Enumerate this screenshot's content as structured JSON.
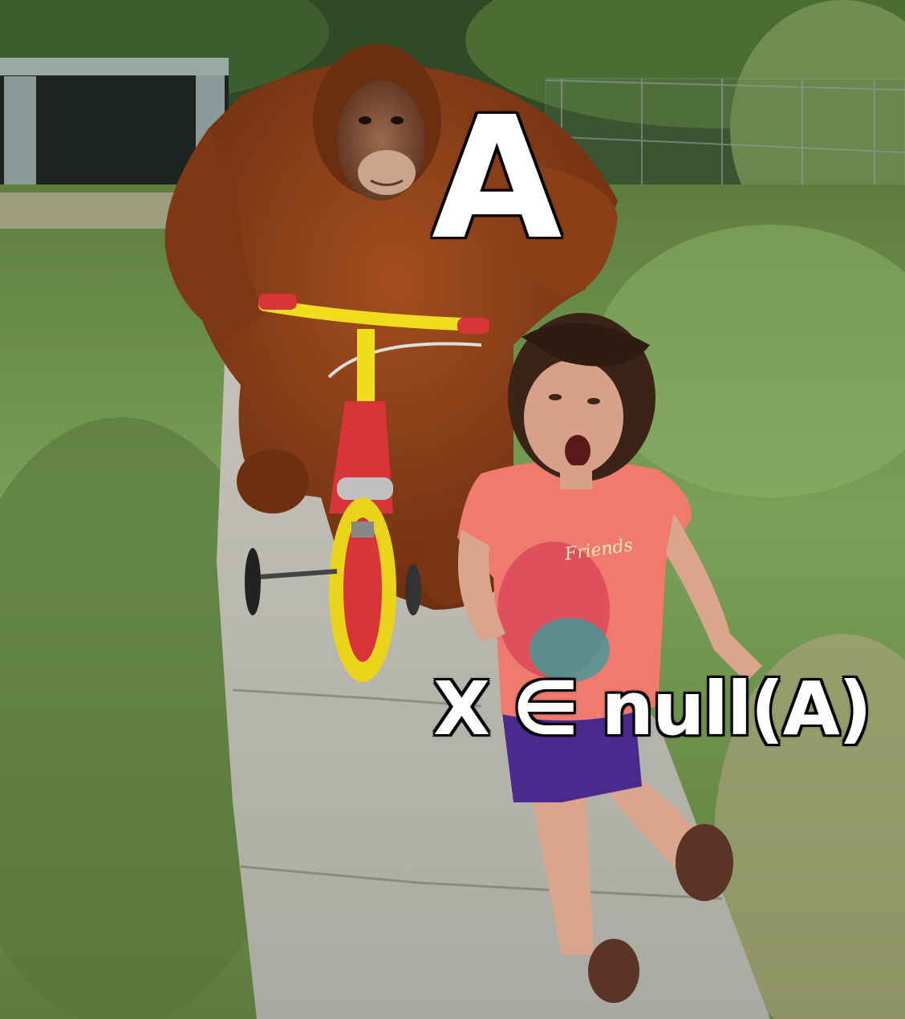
{
  "meme": {
    "top_caption": "A",
    "bottom_caption": "X ∈ null(A)",
    "shirt_text": "Friends"
  },
  "colors": {
    "grass": "#6f9050",
    "path": "#b9bab3",
    "orangutan": "#8a3e16",
    "bike_yellow": "#f0de1e",
    "bike_red": "#d8343a",
    "shirt": "#f07a6c",
    "shorts": "#4a2a8c"
  }
}
